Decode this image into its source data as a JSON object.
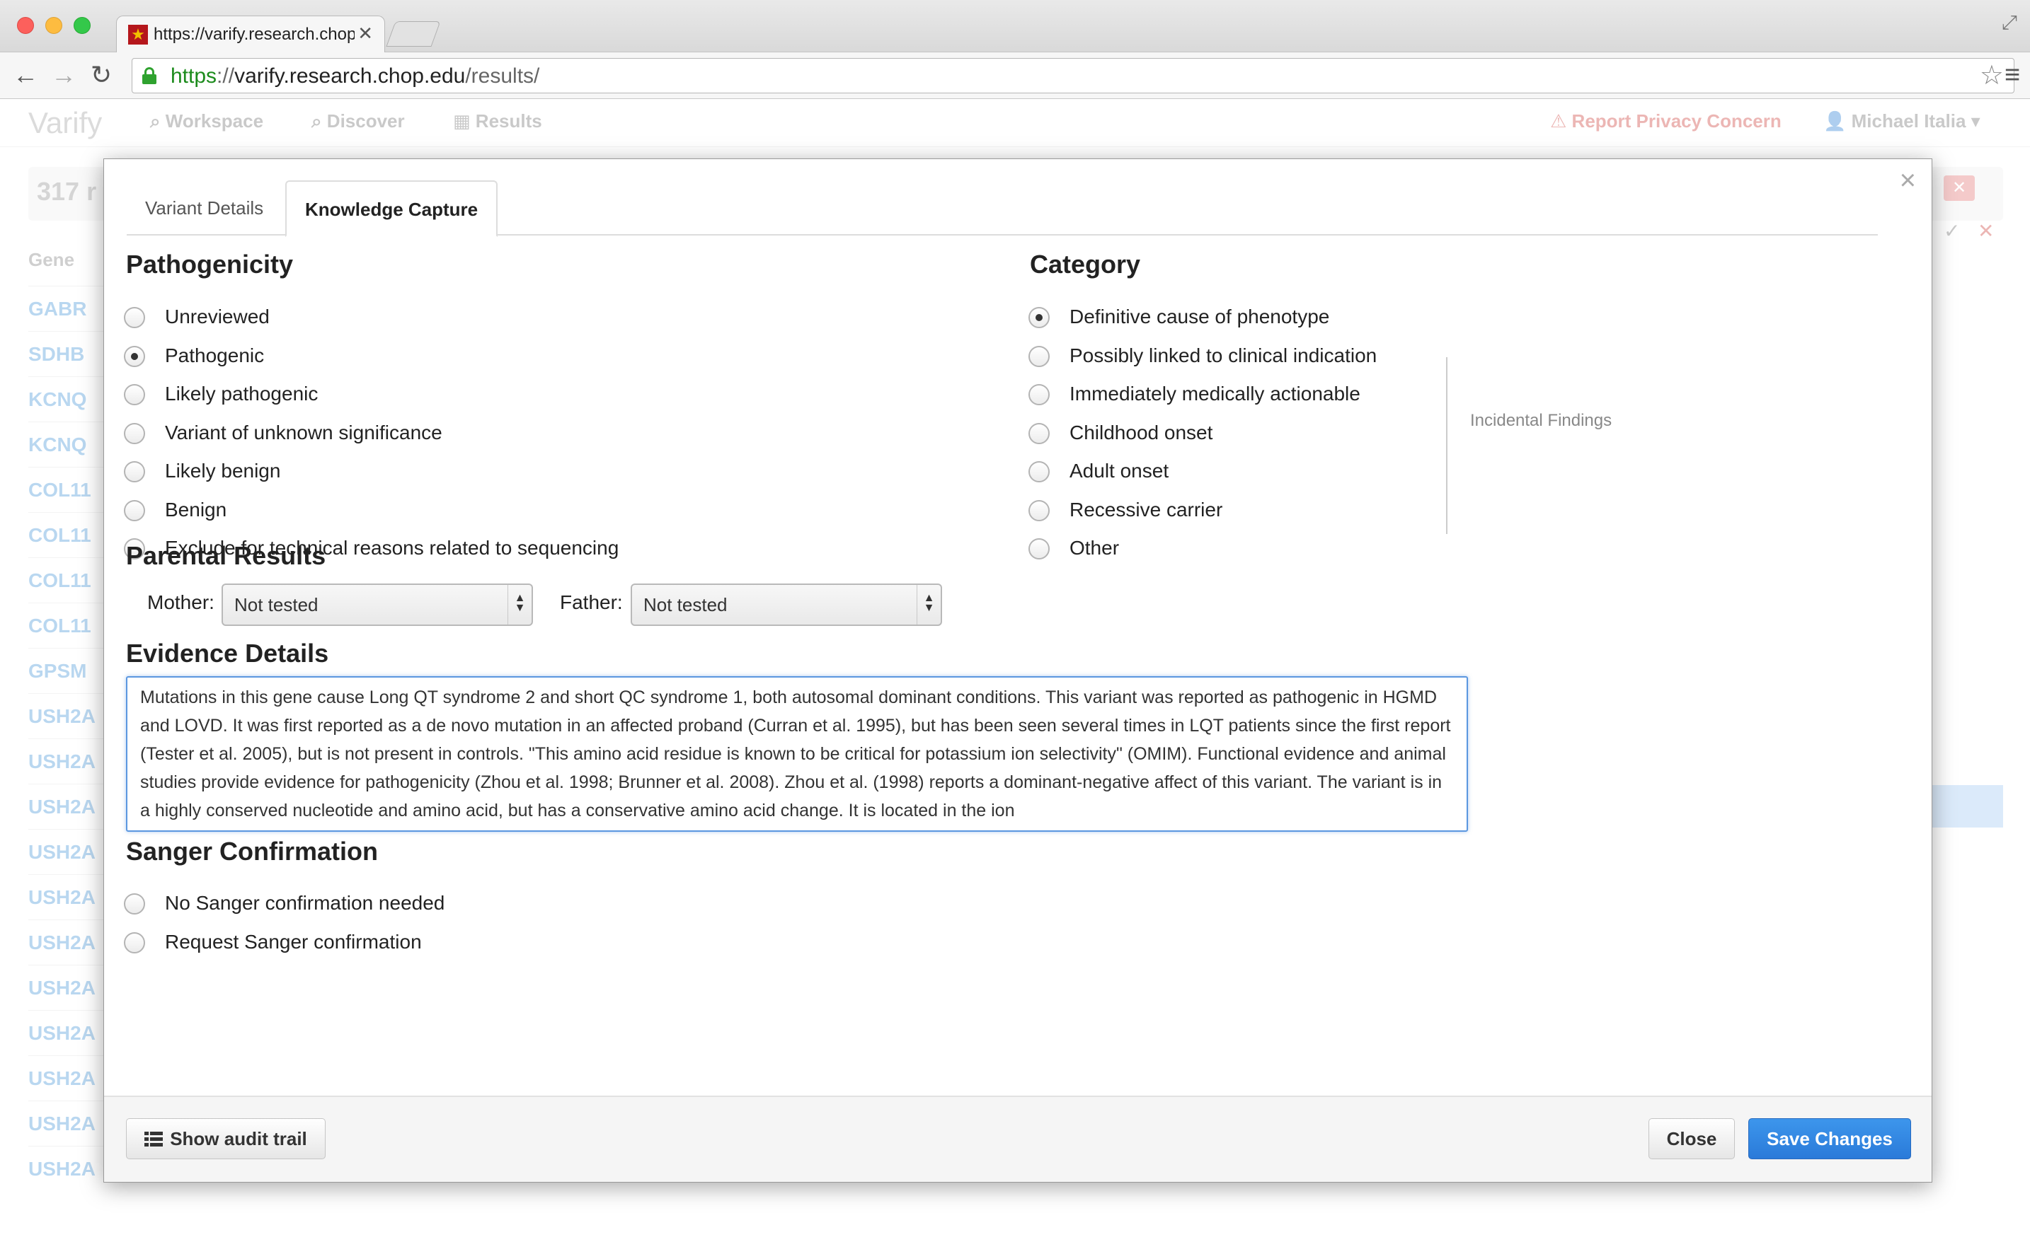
{
  "browser": {
    "tab_title": "https://varify.research.chop.edu/results/",
    "url_scheme": "https",
    "url_sep": "://",
    "url_host": "varify.research.chop.edu",
    "url_path": "/results/"
  },
  "app": {
    "brand": "Varify",
    "nav": [
      "Workspace",
      "Discover",
      "Results"
    ],
    "privacy": "Report Privacy Concern",
    "user": "Michael Italia",
    "results_count": "317 r",
    "gene_header": "Gene",
    "genes": [
      "GABR",
      "SDHB",
      "KCNQ",
      "KCNQ",
      "COL11",
      "COL11",
      "COL11",
      "COL11",
      "GPSM",
      "USH2A",
      "USH2A",
      "USH2A",
      "USH2A",
      "USH2A",
      "USH2A",
      "USH2A",
      "USH2A",
      "USH2A",
      "USH2A",
      "USH2A"
    ]
  },
  "modal": {
    "tabs": {
      "variant_details": "Variant Details",
      "knowledge_capture": "Knowledge Capture"
    },
    "pathogenicity": {
      "title": "Pathogenicity",
      "options": [
        "Unreviewed",
        "Pathogenic",
        "Likely pathogenic",
        "Variant of unknown significance",
        "Likely benign",
        "Benign",
        "Exclude for technical reasons related to sequencing"
      ],
      "selected": "Pathogenic"
    },
    "category": {
      "title": "Category",
      "options": [
        "Definitive cause of phenotype",
        "Possibly linked to clinical indication",
        "Immediately medically actionable",
        "Childhood onset",
        "Adult onset",
        "Recessive carrier",
        "Other"
      ],
      "selected": "Definitive cause of phenotype",
      "incidental_label": "Incidental Findings"
    },
    "parental": {
      "title": "Parental Results",
      "mother_label": "Mother:",
      "mother_value": "Not tested",
      "father_label": "Father:",
      "father_value": "Not tested"
    },
    "evidence": {
      "title": "Evidence Details",
      "text": "Mutations in this gene cause Long QT syndrome 2 and short QC syndrome 1, both autosomal dominant conditions. This variant was reported as pathogenic in HGMD and LOVD. It was first reported as a de novo mutation in an affected proband (Curran et al. 1995), but has been seen several times in LQT patients since the first report (Tester et al. 2005), but is not present in controls. \"This amino acid residue is known to be critical for potassium ion selectivity\" (OMIM). Functional evidence and animal studies provide evidence for pathogenicity (Zhou et al. 1998; Brunner et al. 2008). Zhou et al. (1998) reports a dominant-negative affect of this variant. The variant is in a highly conserved nucleotide and amino acid, but has a conservative amino acid change. It is located in the ion"
    },
    "sanger": {
      "title": "Sanger Confirmation",
      "options": [
        "No Sanger confirmation needed",
        "Request Sanger confirmation"
      ]
    },
    "footer": {
      "audit_label": "Show audit trail",
      "close_label": "Close",
      "save_label": "Save Changes"
    }
  }
}
